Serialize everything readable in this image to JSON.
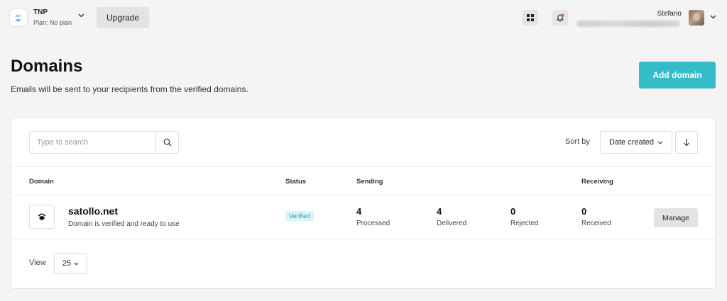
{
  "workspace": {
    "name": "TNP",
    "plan": "Plan: No plan"
  },
  "topbar": {
    "upgrade_label": "Upgrade",
    "apps_icon": "grid-icon",
    "notifications_icon": "bell-icon",
    "user": {
      "name": "Stefano"
    }
  },
  "page": {
    "title": "Domains",
    "subtitle": "Emails will be sent to your recipients from the verified domains.",
    "add_domain_label": "Add domain"
  },
  "toolbar": {
    "search_placeholder": "Type to search",
    "sort_label": "Sort by",
    "sort_value": "Date created"
  },
  "table": {
    "headers": {
      "domain": "Domain",
      "status": "Status",
      "sending": "Sending",
      "receiving": "Receiving"
    },
    "rows": [
      {
        "domain": "satollo.net",
        "description": "Domain is verified and ready to use",
        "status": "Verified",
        "processed": {
          "value": "4",
          "label": "Processed"
        },
        "delivered": {
          "value": "4",
          "label": "Delivered"
        },
        "rejected": {
          "value": "0",
          "label": "Rejected"
        },
        "received": {
          "value": "0",
          "label": "Received"
        },
        "action_label": "Manage"
      }
    ]
  },
  "footer": {
    "view_label": "View",
    "page_size": "25"
  },
  "colors": {
    "accent": "#35bcc9",
    "badge_bg": "#d9f4f4",
    "badge_text": "#2aa3a9",
    "background": "#f4f4f5"
  }
}
